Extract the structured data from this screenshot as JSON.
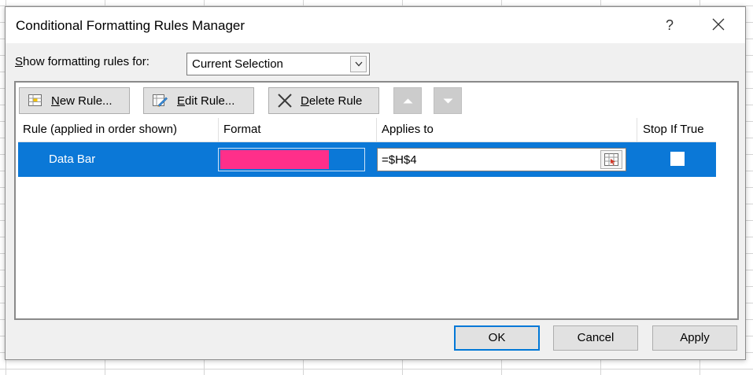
{
  "dialog": {
    "title": "Conditional Formatting Rules Manager",
    "help_glyph": "?",
    "close_icon": "close-x-icon"
  },
  "scope": {
    "label_accel": "S",
    "label_rest": "how formatting rules for:",
    "value": "Current Selection"
  },
  "toolbar": {
    "new_rule": {
      "accel": "N",
      "rest": "ew Rule...",
      "icon": "new-rule-icon"
    },
    "edit_rule": {
      "accel": "E",
      "rest": "dit Rule...",
      "icon": "edit-rule-icon"
    },
    "delete_rule": {
      "accel": "D",
      "rest": "elete Rule",
      "icon": "delete-x-icon"
    },
    "move_up_icon": "arrow-up-icon",
    "move_down_icon": "arrow-down-icon"
  },
  "grid": {
    "columns": [
      "Rule (applied in order shown)",
      "Format",
      "Applies to",
      "Stop If True"
    ],
    "rows": [
      {
        "rule": "Data Bar",
        "format_color": "#ff2f8a",
        "applies_to": "=$H$4",
        "stop_if_true": false,
        "selected": true
      }
    ]
  },
  "footer": {
    "ok": "OK",
    "cancel": "Cancel",
    "apply": "Apply"
  },
  "colors": {
    "selection": "#0b78d7",
    "data_bar": "#ff2f8a",
    "default_button_border": "#0078d7"
  }
}
